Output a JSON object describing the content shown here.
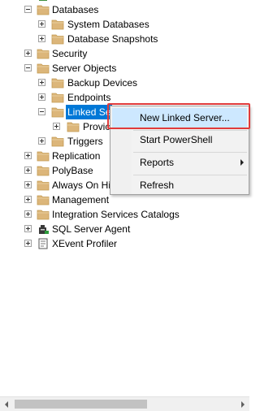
{
  "tree": {
    "databases": "Databases",
    "system_databases": "System Databases",
    "database_snapshots": "Database Snapshots",
    "security": "Security",
    "server_objects": "Server Objects",
    "backup_devices": "Backup Devices",
    "endpoints": "Endpoints",
    "linked_servers": "Linked Se",
    "providers": "Provic",
    "triggers": "Triggers",
    "replication": "Replication",
    "polybase": "PolyBase",
    "always_on": "Always On Hi",
    "management": "Management",
    "integration_services": "Integration Services Catalogs",
    "sql_server_agent": "SQL Server Agent",
    "xevent_profiler": "XEvent Profiler"
  },
  "context_menu": {
    "new_linked_server": "New Linked Server...",
    "start_powershell": "Start PowerShell",
    "reports": "Reports",
    "refresh": "Refresh"
  },
  "colors": {
    "selection": "#0078d7",
    "menu_highlight": "#cde8ff",
    "annotation_outline": "#e03b3b",
    "folder": "#dcb67a"
  }
}
